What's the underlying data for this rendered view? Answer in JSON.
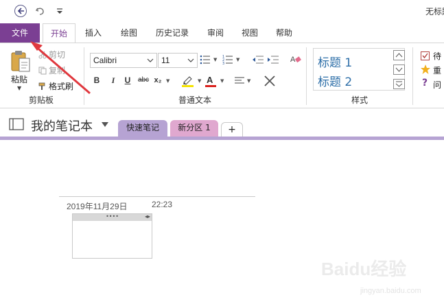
{
  "window": {
    "title": "无标题"
  },
  "tabs": {
    "file": "文件",
    "home": "开始",
    "insert": "插入",
    "draw": "绘图",
    "history": "历史记录",
    "review": "审阅",
    "view": "视图",
    "help": "帮助"
  },
  "clipboard": {
    "paste": "粘贴",
    "cut": "剪切",
    "copy": "复制",
    "format_painter": "格式刷",
    "group_label": "剪贴板"
  },
  "basic_text": {
    "font_name": "Calibri",
    "font_size": "11",
    "bold": "B",
    "italic": "I",
    "underline": "U",
    "strikethrough": "abc",
    "subscript": "x₂",
    "group_label": "普通文本"
  },
  "styles": {
    "heading1": "标题 1",
    "heading2": "标题 2",
    "group_label": "样式"
  },
  "tags": {
    "todo": "待",
    "important": "重",
    "question": "问"
  },
  "notebook": {
    "name": "我的笔记本",
    "sections": [
      {
        "label": "快速笔记",
        "color": "#b6a3d3"
      },
      {
        "label": "新分区 1",
        "color": "#e0a8cf"
      }
    ],
    "add_label": "+"
  },
  "page": {
    "date": "2019年11月29日",
    "time": "22:23",
    "handle_dots": "••••",
    "resize": "◂▸"
  },
  "colors": {
    "accent": "#7b3f93",
    "annotation": "#e0383e",
    "highlight": "#f5e400",
    "font_color": "#d9201c"
  },
  "watermark": {
    "brand": "Baidu经验",
    "url": "jingyan.baidu.com"
  }
}
